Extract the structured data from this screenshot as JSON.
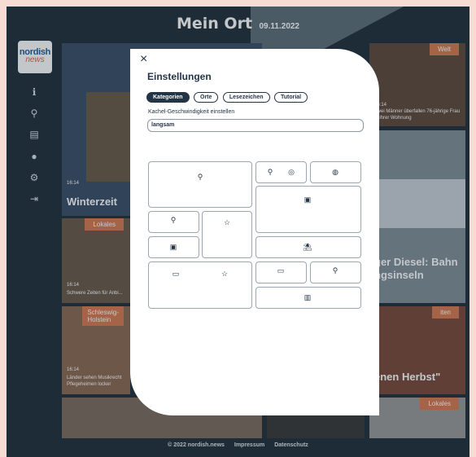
{
  "header": {
    "title": "Mein Ort",
    "date": "09.11.2022"
  },
  "logo": {
    "line1": "nordish",
    "line2": "news"
  },
  "sidebar": {
    "items": [
      {
        "icon": "info-icon",
        "glyph": "ℹ"
      },
      {
        "icon": "search-icon",
        "glyph": "⚲"
      },
      {
        "icon": "archive-icon",
        "glyph": "▤"
      },
      {
        "icon": "user-icon",
        "glyph": "●"
      },
      {
        "icon": "gear-icon",
        "glyph": "⚙"
      },
      {
        "icon": "logout-icon",
        "glyph": "⇥"
      }
    ]
  },
  "tiles": {
    "welt_tag": "Welt",
    "welt_time": "16:14",
    "welt_caption": "Zwei Männer überfallen 76-jährige Frau in ihrer Wohnung",
    "winterzeit_time": "16:14",
    "winterzeit_title": "Winterzeit",
    "lokales_tag": "Lokales",
    "schwere_time": "16:14",
    "schwere_caption": "Schwere Zeiten für Anbi...",
    "diesel_title_1": "ger Diesel: Bahn",
    "diesel_title_2": "ngsinseln",
    "sh_tag_1": "Schleswig-",
    "sh_tag_2": "Holstein",
    "laender_time": "16:14",
    "laender_caption_1": "Länder sehen Musikrecht",
    "laender_caption_2": "Pflegeheimen locker",
    "herbst_tag": "iten",
    "herbst_title": "enen Herbst\"",
    "lokales2_tag": "Lokales"
  },
  "modal": {
    "close": "×",
    "title": "Einstellungen",
    "tabs": [
      "Kategorien",
      "Orte",
      "Lesezeichen",
      "Tutorial"
    ],
    "speed_label": "Kachel-Geschwindigkeit einstellen",
    "speed_value": "langsam",
    "layout_icons": {
      "pin": "⚲",
      "target": "◎",
      "globe": "◍",
      "newspaper": "▣",
      "star": "☆",
      "beach": "⛱",
      "monitor": "▭",
      "chart": "▥"
    }
  },
  "footer": {
    "copyright": "© 2022 nordish.news",
    "imprint": "Impressum",
    "privacy": "Datenschutz"
  }
}
